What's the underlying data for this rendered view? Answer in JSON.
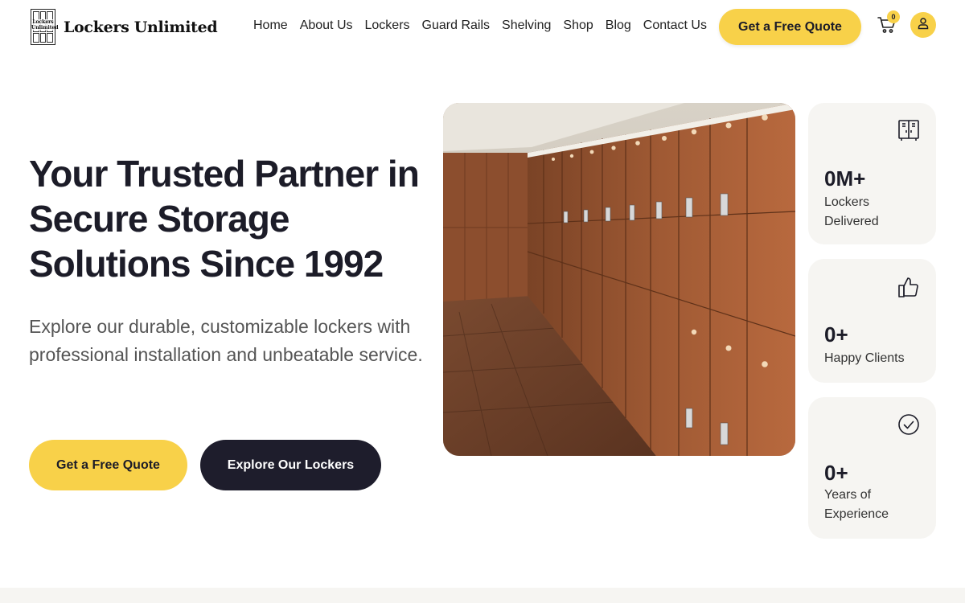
{
  "header": {
    "brand": "Lockers Unlimited",
    "logo_mark_text": "Lockers Unlimited",
    "nav": [
      "Home",
      "About Us",
      "Lockers",
      "Guard Rails",
      "Shelving",
      "Shop",
      "Blog",
      "Contact Us"
    ],
    "quote_button": "Get a Free Quote",
    "cart_count": "0",
    "icons": {
      "cart": "cart-icon",
      "user": "user-icon"
    }
  },
  "hero": {
    "title": "Your Trusted Partner in Secure Storage Solutions Since 1992",
    "subtitle": "Explore our durable, customizable lockers with professional installation and unbeatable service.",
    "primary_button": "Get a Free Quote",
    "secondary_button": "Explore Our Lockers",
    "image_alt": "locker-room-photo"
  },
  "stats": [
    {
      "icon": "locker-icon",
      "value": "0M+",
      "label": "Lockers Delivered"
    },
    {
      "icon": "thumbs-up-icon",
      "value": "0+",
      "label": "Happy Clients"
    },
    {
      "icon": "check-circle-icon",
      "value": "0+",
      "label": "Years of Experience"
    }
  ],
  "colors": {
    "accent": "#f8d149",
    "dark": "#1e1d2c",
    "card_bg": "#f6f5f2",
    "text": "#1c1c28"
  }
}
